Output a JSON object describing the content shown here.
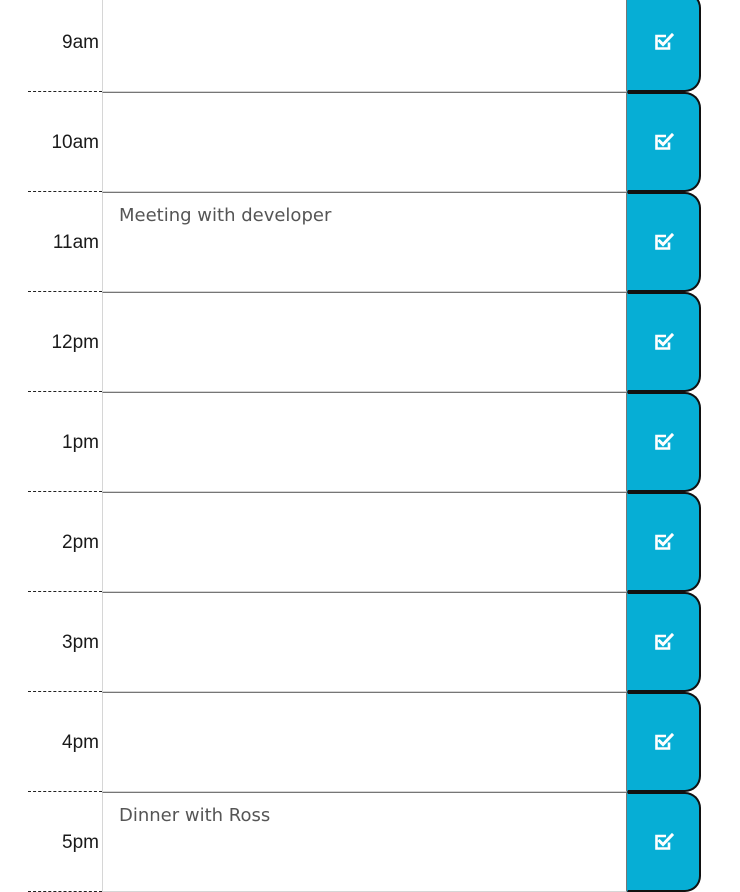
{
  "planner": {
    "rows": [
      {
        "hour": "9am",
        "text": ""
      },
      {
        "hour": "10am",
        "text": ""
      },
      {
        "hour": "11am",
        "text": "Meeting with developer"
      },
      {
        "hour": "12pm",
        "text": ""
      },
      {
        "hour": "1pm",
        "text": ""
      },
      {
        "hour": "2pm",
        "text": ""
      },
      {
        "hour": "3pm",
        "text": ""
      },
      {
        "hour": "4pm",
        "text": ""
      },
      {
        "hour": "5pm",
        "text": "Dinner with Ross"
      }
    ],
    "save_icon": "save-check-icon"
  },
  "colors": {
    "accent": "#06aed5",
    "border": "#d6d6d6",
    "text": "#555555"
  }
}
